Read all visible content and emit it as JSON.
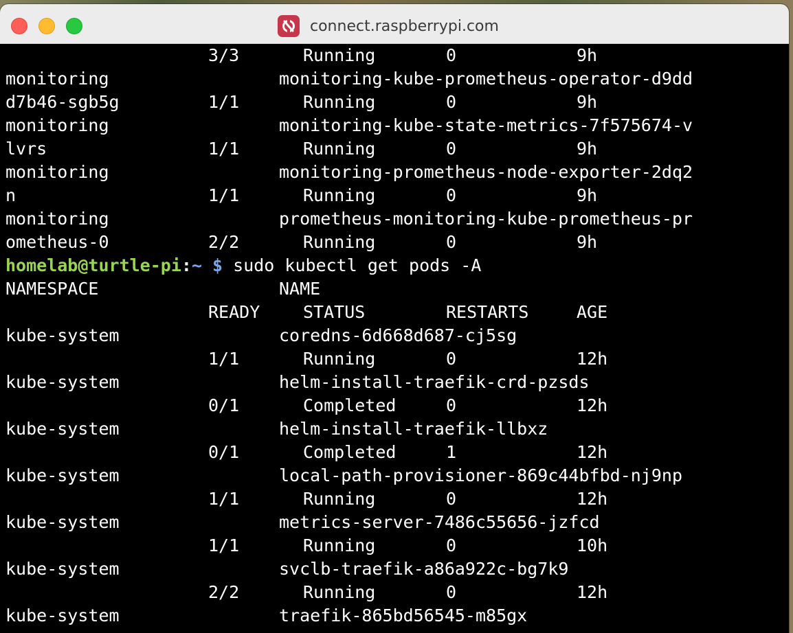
{
  "window": {
    "title": "connect.raspberrypi.com",
    "app_icon": "raspberry-pi-connect-icon",
    "colors": {
      "terminal_bg": "#000000",
      "text": "#ffffff",
      "prompt_user": "#9ad455",
      "prompt_path": "#7aa6e6",
      "app_icon": "#c7364a"
    }
  },
  "terminal": {
    "previous_output": [
      {
        "ready": "3/3",
        "status": "Running",
        "restarts": "0",
        "age": "9h"
      },
      {
        "namespace": "monitoring",
        "name": "monitoring-kube-prometheus-operator-d9dd"
      },
      {
        "namespace": "d7b46-sgb5g",
        "ready": "1/1",
        "status": "Running",
        "restarts": "0",
        "age": "9h"
      },
      {
        "namespace": "monitoring",
        "name": "monitoring-kube-state-metrics-7f575674-v"
      },
      {
        "namespace": "lvrs",
        "ready": "1/1",
        "status": "Running",
        "restarts": "0",
        "age": "9h"
      },
      {
        "namespace": "monitoring",
        "name": "monitoring-prometheus-node-exporter-2dq2"
      },
      {
        "namespace": "n",
        "ready": "1/1",
        "status": "Running",
        "restarts": "0",
        "age": "9h"
      },
      {
        "namespace": "monitoring",
        "name": "prometheus-monitoring-kube-prometheus-pr"
      },
      {
        "namespace": "ometheus-0",
        "ready": "2/2",
        "status": "Running",
        "restarts": "0",
        "age": "9h"
      }
    ],
    "prompt": {
      "user_host": "homelab@turtle-pi",
      "separator": ":",
      "path": "~",
      "symbol": " $ ",
      "command": "sudo kubectl get pods -A"
    },
    "header_row1": {
      "namespace": "NAMESPACE",
      "name": "NAME"
    },
    "header_row2": {
      "ready": "READY",
      "status": "STATUS",
      "restarts": "RESTARTS",
      "age": "AGE"
    },
    "pods": [
      {
        "namespace": "kube-system",
        "name": "coredns-6d668d687-cj5sg",
        "ready": "1/1",
        "status": "Running",
        "restarts": "0",
        "age": "12h"
      },
      {
        "namespace": "kube-system",
        "name": "helm-install-traefik-crd-pzsds",
        "ready": "0/1",
        "status": "Completed",
        "restarts": "0",
        "age": "12h"
      },
      {
        "namespace": "kube-system",
        "name": "helm-install-traefik-llbxz",
        "ready": "0/1",
        "status": "Completed",
        "restarts": "1",
        "age": "12h"
      },
      {
        "namespace": "kube-system",
        "name": "local-path-provisioner-869c44bfbd-nj9np",
        "ready": "1/1",
        "status": "Running",
        "restarts": "0",
        "age": "12h"
      },
      {
        "namespace": "kube-system",
        "name": "metrics-server-7486c55656-jzfcd",
        "ready": "1/1",
        "status": "Running",
        "restarts": "0",
        "age": "10h"
      },
      {
        "namespace": "kube-system",
        "name": "svclb-traefik-a86a922c-bg7k9",
        "ready": "2/2",
        "status": "Running",
        "restarts": "0",
        "age": "12h"
      },
      {
        "namespace": "kube-system",
        "name": "traefik-865bd56545-m85gx"
      }
    ]
  }
}
